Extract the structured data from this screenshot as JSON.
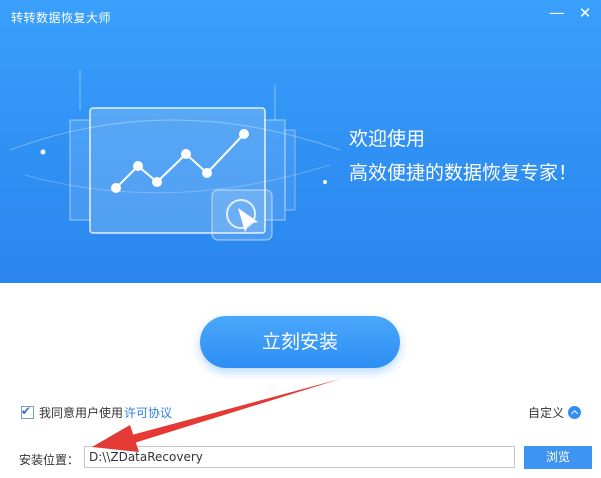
{
  "window": {
    "title": "转转数据恢复大师",
    "minimize_glyph": "—",
    "close_glyph": "✕"
  },
  "banner": {
    "welcome": "欢迎使用",
    "slogan": "高效便捷的数据恢复专家！"
  },
  "install": {
    "label": "立刻安装"
  },
  "agreement": {
    "checked": true,
    "text": "我同意用户使用",
    "link": "许可协议"
  },
  "custom": {
    "label": "自定义",
    "icon": "chevron-up-icon"
  },
  "location": {
    "label": "安装位置：",
    "value": "D:\\\\ZDataRecovery",
    "browse_label": "浏览"
  },
  "colors": {
    "banner": "#2f8ff3",
    "accent": "#3d94f3",
    "link": "#2f7fe0",
    "annotation_arrow": "#e53935"
  }
}
